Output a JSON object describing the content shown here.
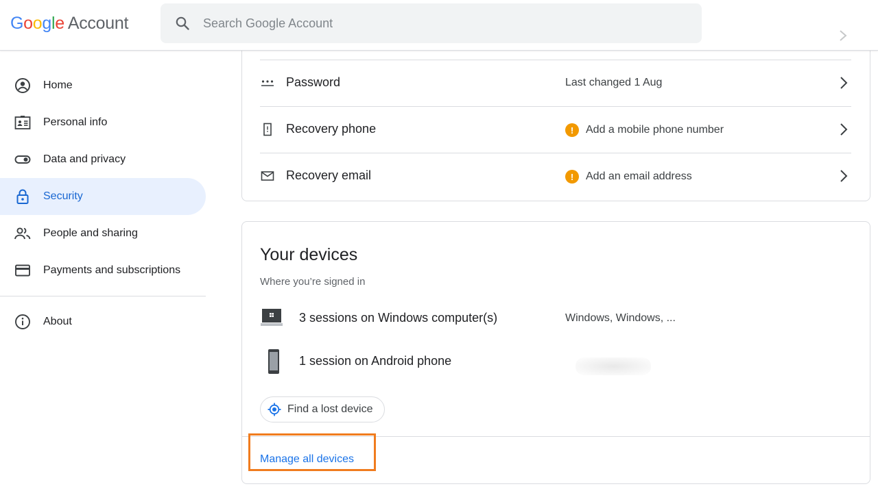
{
  "header": {
    "logo_letters": [
      {
        "ch": "G",
        "color": "#4285F4"
      },
      {
        "ch": "o",
        "color": "#EA4335"
      },
      {
        "ch": "o",
        "color": "#FBBC05"
      },
      {
        "ch": "g",
        "color": "#4285F4"
      },
      {
        "ch": "l",
        "color": "#34A853"
      },
      {
        "ch": "e",
        "color": "#EA4335"
      }
    ],
    "logo_suffix": "Account",
    "search_placeholder": "Search Google Account"
  },
  "sidebar": {
    "items": [
      {
        "label": "Home",
        "icon": "account-circle-icon",
        "active": false
      },
      {
        "label": "Personal info",
        "icon": "id-card-icon",
        "active": false
      },
      {
        "label": "Data and privacy",
        "icon": "toggle-icon",
        "active": false
      },
      {
        "label": "Security",
        "icon": "lock-icon",
        "active": true
      },
      {
        "label": "People and sharing",
        "icon": "people-icon",
        "active": false
      },
      {
        "label": "Payments and subscriptions",
        "icon": "credit-card-icon",
        "active": false
      }
    ],
    "footer_items": [
      {
        "label": "About",
        "icon": "info-icon"
      }
    ]
  },
  "signin_card": {
    "rows": [
      {
        "label": "Password",
        "value": "Last changed 1 Aug",
        "icon": "password-dots-icon",
        "warning": false
      },
      {
        "label": "Recovery phone",
        "value": "Add a mobile phone number",
        "icon": "phone-icon",
        "warning": true
      },
      {
        "label": "Recovery email",
        "value": "Add an email address",
        "icon": "mail-icon",
        "warning": true
      }
    ]
  },
  "devices_card": {
    "title": "Your devices",
    "subtitle": "Where you’re signed in",
    "devices": [
      {
        "label": "3 sessions on Windows computer(s)",
        "value": "Windows, Windows, ...",
        "icon": "windows-laptop-icon"
      },
      {
        "label": "1 session on Android phone",
        "value": "",
        "icon": "android-phone-icon"
      }
    ],
    "find_button": "Find a lost device",
    "manage_link": "Manage all devices"
  },
  "colors": {
    "accent": "#1a73e8",
    "active_bg": "#e8f0fe",
    "warning": "#f29900",
    "highlight": "#f07c1e"
  }
}
